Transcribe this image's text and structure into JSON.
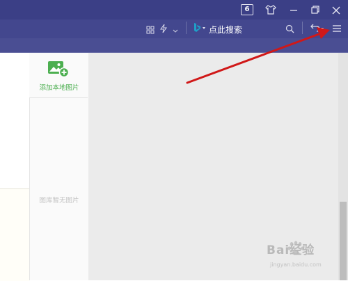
{
  "titlebar": {
    "tab_count": "6",
    "icons": [
      "skin-icon",
      "minimize-icon",
      "restore-icon",
      "close-icon"
    ]
  },
  "toolbar": {
    "icons": [
      "apps-grid-icon",
      "lightning-icon",
      "chevron-down-icon",
      "bing-icon",
      "search-icon",
      "undo-icon",
      "menu-icon"
    ],
    "search_label": "点此搜索"
  },
  "sidebar": {
    "add_local_image": "添加本地图片",
    "empty_text": "图库暂无图片"
  },
  "watermark": {
    "brand": "Bai经验",
    "url": "jingyan.baidu.com"
  },
  "annotation": {
    "arrow_color": "#d01818"
  }
}
